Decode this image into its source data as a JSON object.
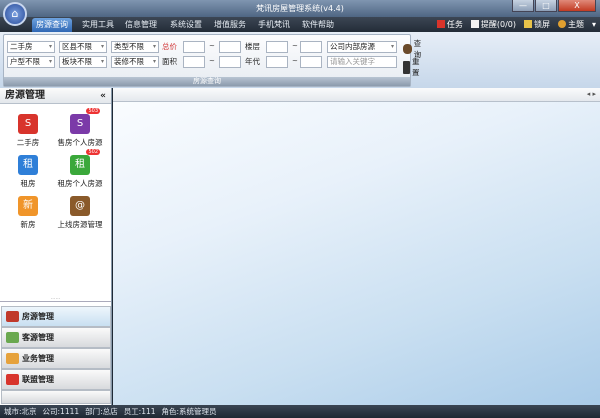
{
  "window": {
    "title": "梵讯房屋管理系统(v4.4)",
    "min": "—",
    "max": "□",
    "close": "X",
    "logo": "⌂"
  },
  "menu": {
    "tabs": [
      "房源查询",
      "实用工具",
      "信息管理",
      "系统设置",
      "增值服务",
      "手机梵讯",
      "软件帮助"
    ],
    "right": [
      {
        "label": "任务",
        "icon": "task-icon",
        "color": "#d9342b"
      },
      {
        "label": "提醒(0/0)",
        "icon": "reminder-icon",
        "color": "#f2f2f2"
      },
      {
        "label": "锁屏",
        "icon": "lock-screen-icon",
        "color": "#e8c34a"
      },
      {
        "label": "主题",
        "icon": "theme-icon",
        "color": "#e0a030"
      }
    ],
    "more": "▾"
  },
  "search": {
    "type": "二手房",
    "district": "区县不限",
    "category": "类型不限",
    "layout": "户型不限",
    "block": "板块不限",
    "decoration": "装修不限",
    "total_price_label": "总价",
    "area_label": "面积",
    "floor_label": "楼层",
    "year_label": "年代",
    "tilde": "~",
    "source": "公司内部房源",
    "keyword_placeholder": "请输入关键字",
    "query_label": "查询",
    "reset_label": "重置",
    "panel_label": "房源查询"
  },
  "left": {
    "title": "房源管理",
    "collapse": "«",
    "items": [
      {
        "label": "二手房",
        "color": "#d8342c",
        "glyph": "S"
      },
      {
        "label": "售房个人房源",
        "color": "#7b3aa8",
        "glyph": "S",
        "badge": "503"
      },
      {
        "label": "租房",
        "color": "#2f7fd8",
        "glyph": "租"
      },
      {
        "label": "租房个人房源",
        "color": "#3aa83a",
        "glyph": "租",
        "badge": "502"
      },
      {
        "label": "新房",
        "color": "#f0952a",
        "glyph": "新"
      },
      {
        "label": "上线房源管理",
        "color": "#8a5a2a",
        "glyph": "@"
      }
    ],
    "splitter": "······",
    "nav": [
      {
        "label": "房源管理",
        "color": "#c0392b"
      },
      {
        "label": "客源管理",
        "color": "#6aa84f"
      },
      {
        "label": "业务管理",
        "color": "#e6a23c"
      },
      {
        "label": "联盟管理",
        "color": "#d8342c"
      }
    ]
  },
  "main": {
    "arrows": "◂ ▸"
  },
  "status": [
    "城市:北京",
    "公司:1111",
    "部门:总店",
    "员工:111",
    "角色:系统管理员"
  ]
}
